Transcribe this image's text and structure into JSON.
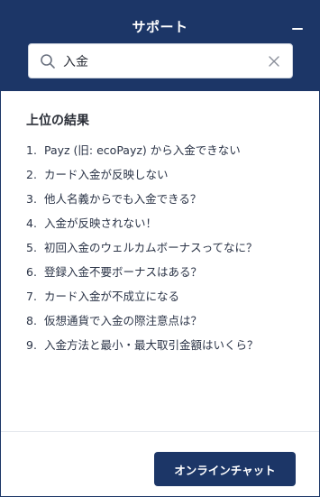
{
  "header": {
    "title": "サポート",
    "minimize_icon": "minimize-icon"
  },
  "search": {
    "value": "入金",
    "search_icon": "search-icon",
    "clear_icon": "close-icon"
  },
  "results": {
    "heading": "上位の結果",
    "items": [
      {
        "num": "1.",
        "text": "Payz (旧: ecoPayz) から入金できない"
      },
      {
        "num": "2.",
        "text": "カード入金が反映しない"
      },
      {
        "num": "3.",
        "text": "他人名義からでも入金できる？"
      },
      {
        "num": "4.",
        "text": "入金が反映されない！"
      },
      {
        "num": "5.",
        "text": "初回入金のウェルカムボーナスってなに？"
      },
      {
        "num": "6.",
        "text": "登録入金不要ボーナスはある？"
      },
      {
        "num": "7.",
        "text": "カード入金が不成立になる"
      },
      {
        "num": "8.",
        "text": "仮想通貨で入金の際注意点は？"
      },
      {
        "num": "9.",
        "text": "入金方法と最小・最大取引金額はいくら？"
      }
    ]
  },
  "footer": {
    "chat_button_label": "オンラインチャット"
  },
  "colors": {
    "brand": "#1c3667",
    "text": "#2b3447",
    "background": "#ffffff"
  }
}
